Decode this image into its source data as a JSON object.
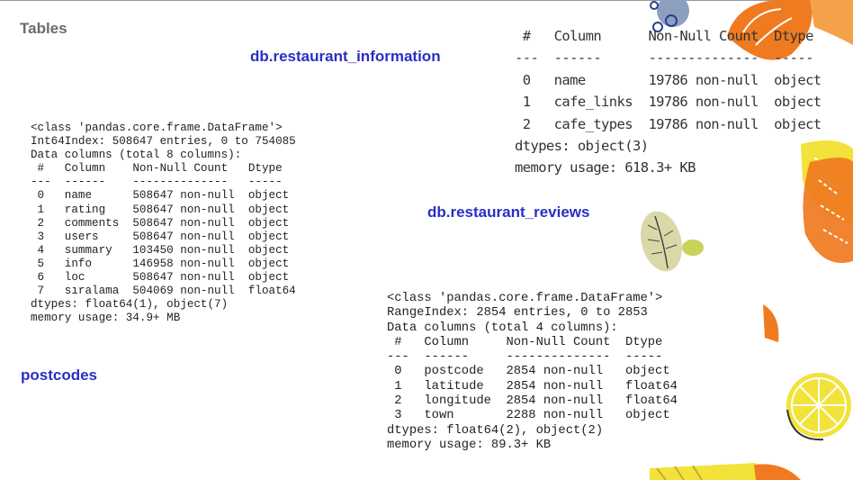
{
  "slide": {
    "title": "Tables",
    "labels": {
      "restaurant_information": "db.restaurant_information",
      "restaurant_reviews": "db.restaurant_reviews",
      "postcodes": "postcodes"
    }
  },
  "info_restaurant_information": {
    "lines": [
      " #   Column      Non-Null Count  Dtype",
      "---  ------      --------------  -----",
      " 0   name        19786 non-null  object",
      " 1   cafe_links  19786 non-null  object",
      " 2   cafe_types  19786 non-null  object",
      "dtypes: object(3)",
      "memory usage: 618.3+ KB"
    ]
  },
  "info_main_dataframe": {
    "lines": [
      "<class 'pandas.core.frame.DataFrame'>",
      "Int64Index: 508647 entries, 0 to 754085",
      "Data columns (total 8 columns):",
      " #   Column    Non-Null Count   Dtype",
      "---  ------    --------------   -----",
      " 0   name      508647 non-null  object",
      " 1   rating    508647 non-null  object",
      " 2   comments  508647 non-null  object",
      " 3   users     508647 non-null  object",
      " 4   summary   103450 non-null  object",
      " 5   info      146958 non-null  object",
      " 6   loc       508647 non-null  object",
      " 7   sıralama  504069 non-null  float64",
      "dtypes: float64(1), object(7)",
      "memory usage: 34.9+ MB"
    ]
  },
  "info_postcodes": {
    "lines": [
      "<class 'pandas.core.frame.DataFrame'>",
      "RangeIndex: 2854 entries, 0 to 2853",
      "Data columns (total 4 columns):",
      " #   Column     Non-Null Count  Dtype",
      "---  ------     --------------  -----",
      " 0   postcode   2854 non-null   object",
      " 1   latitude   2854 non-null   float64",
      " 2   longitude  2854 non-null   float64",
      " 3   town       2288 non-null   object",
      "dtypes: float64(2), object(2)",
      "memory usage: 89.3+ KB"
    ]
  },
  "colors": {
    "label_blue": "#2a2fc4",
    "title_gray": "#6b6b6b",
    "orange": "#f07a20",
    "yellow": "#f2e23a"
  }
}
